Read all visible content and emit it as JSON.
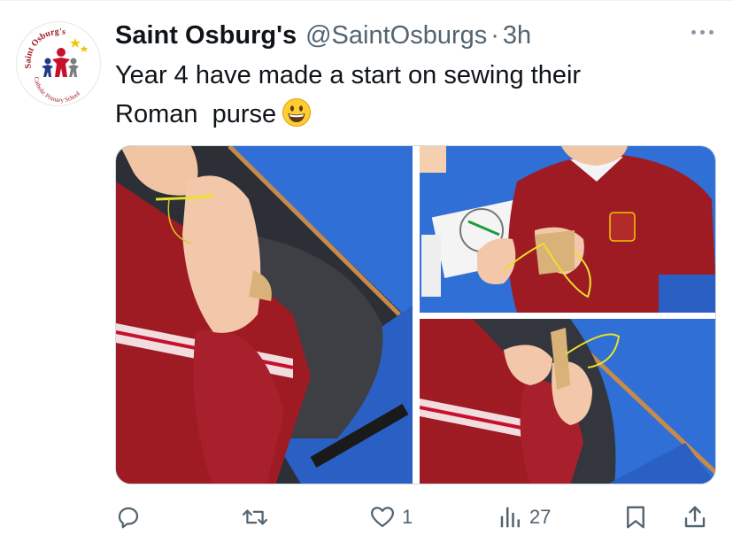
{
  "tweet": {
    "author_name": "Saint Osburg's",
    "handle": "@SaintOsburgs",
    "separator": "·",
    "time": "3h",
    "text_line1": "Year 4 have made a start on sewing their",
    "text_line2": "Roman  purse",
    "emoji": "grinning-face-emoji"
  },
  "avatar": {
    "logo_text_top": "Saint Osburg's",
    "logo_text_bottom": "Catholic Primary School"
  },
  "media": {
    "photos": [
      "photo-child-sewing-closeup",
      "photo-child-sewing-at-desk",
      "photo-child-holding-purse"
    ]
  },
  "actions": {
    "reply_icon": "reply-icon",
    "retweet_icon": "retweet-icon",
    "like_icon": "heart-icon",
    "like_count": "1",
    "views_icon": "views-icon",
    "views_count": "27",
    "bookmark_icon": "bookmark-icon",
    "share_icon": "share-icon"
  },
  "colors": {
    "text": "#0f1419",
    "secondary": "#536471",
    "desk_blue": "#2f6fd6",
    "uniform_red": "#9e1b24"
  }
}
